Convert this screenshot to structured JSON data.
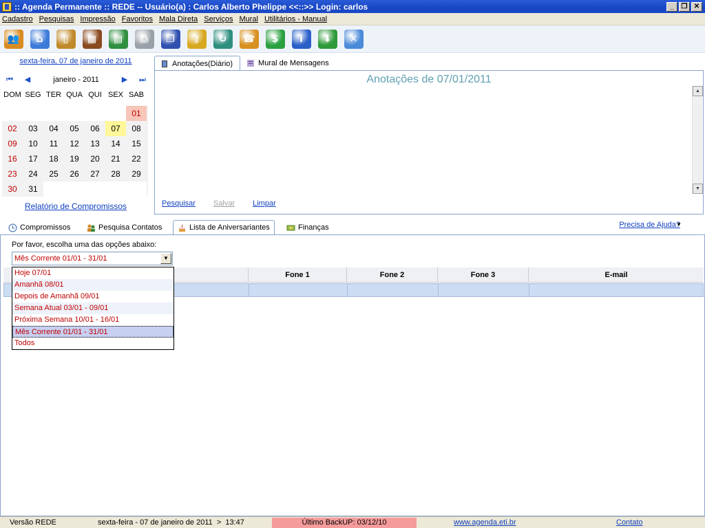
{
  "window": {
    "title": ":: Agenda Permanente :: REDE -- Usuário(a) : Carlos Alberto Phelippe <<::>> Login: carlos",
    "minimize": "_",
    "maximize": "❐",
    "close": "✕"
  },
  "menu": [
    "Cadastro",
    "Pesquisas",
    "Impressão",
    "Favoritos",
    "Mala Direta",
    "Serviços",
    "Mural",
    "Utilitários - Manual"
  ],
  "toolbar": {
    "icons": [
      "contacts-icon",
      "home-icon",
      "book-icon",
      "calendar-icon",
      "agenda-book-icon",
      "printer-icon",
      "windows-icon",
      "key-icon",
      "refresh-icon",
      "phone-icon",
      "money-icon",
      "info-icon",
      "download-globe-icon",
      "close-window-icon"
    ],
    "colors": {
      "contacts-icon": "#d98a20",
      "home-icon": "#3d7bd8",
      "book-icon": "#c08a2a",
      "calendar-icon": "#8a4a20",
      "agenda-book-icon": "#2f8f3f",
      "printer-icon": "#9aa0a8",
      "windows-icon": "#3050b0",
      "key-icon": "#d8a820",
      "refresh-icon": "#2f8f7f",
      "phone-icon": "#d89020",
      "money-icon": "#2aa040",
      "info-icon": "#2a60c8",
      "download-globe-icon": "#2f9a3a",
      "close-window-icon": "#4a8ad8"
    }
  },
  "calendar": {
    "date_link": "sexta-feira, 07 de janeiro de 2011",
    "month_label": "janeiro - 2011",
    "nav": {
      "first": "⏮",
      "prev": "◀",
      "next": "▶",
      "last": "⏭"
    },
    "weekdays": [
      "DOM",
      "SEG",
      "TER",
      "QUA",
      "QUI",
      "SEX",
      "SAB"
    ],
    "days": [
      "",
      "",
      "",
      "",
      "",
      "",
      "01",
      "02",
      "03",
      "04",
      "05",
      "06",
      "07",
      "08",
      "09",
      "10",
      "11",
      "12",
      "13",
      "14",
      "15",
      "16",
      "17",
      "18",
      "19",
      "20",
      "21",
      "22",
      "23",
      "24",
      "25",
      "26",
      "27",
      "28",
      "29",
      "30",
      "31",
      "",
      "",
      "",
      "",
      ""
    ],
    "report_link": "Relatório de Compromissos"
  },
  "notes": {
    "tabs": [
      "Anotações(Diário)",
      "Mural de Mensagens"
    ],
    "title": "Anotações de 07/01/2011",
    "actions": {
      "search": "Pesquisar",
      "save": "Salvar",
      "clear": "Limpar"
    }
  },
  "bottom_tabs": [
    "Compromissos",
    "Pesquisa Contatos",
    "Lista de Aniversariantes",
    "Finanças"
  ],
  "help_link": "Precisa de Ajuda?",
  "birthdays": {
    "prompt": "Por favor, escolha uma das opções abaixo:",
    "selected": "Mês Corrente 01/01 - 31/01",
    "options": [
      "Hoje 07/01",
      "Amanhã 08/01",
      "Depois de Amanhã 09/01",
      "Semana Atual 03/01 - 09/01",
      "Próxima Semana 10/01 - 16/01",
      "Mês Corrente 01/01 - 31/01",
      "Todos"
    ],
    "columns": [
      "",
      "Fone 1",
      "Fone 2",
      "Fone 3",
      "E-mail"
    ]
  },
  "status": {
    "version": "Versão REDE",
    "datetime": "sexta-feira - 07 de janeiro de 2011  >  13:47",
    "backup": "Último BackUP: 03/12/10",
    "website": "www.agenda.eti.br",
    "contact": "Contato"
  }
}
